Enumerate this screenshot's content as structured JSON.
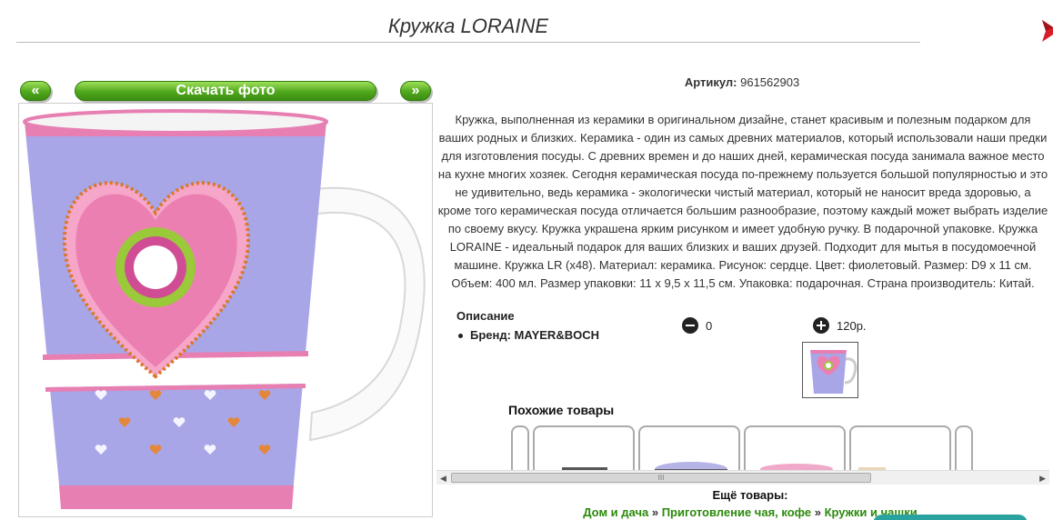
{
  "title": "Кружка LORAINE",
  "nav": {
    "prev": "«",
    "download": "Скачать фото",
    "next": "»"
  },
  "article": {
    "label": "Артикул:",
    "value": "961562903"
  },
  "description": "Кружка, выполненная из керамики в оригинальном дизайне, станет красивым и полезным подарком для ваших родных и близких. Керамика - один из самых древних материалов, который использовали наши предки для изготовления посуды. С древних времен и до наших дней, керамическая посуда занимала важное место на кухне многих хозяек. Сегодня керамическая посуда по-прежнему пользуется большой популярностью и это не удивительно, ведь керамика - экологически чистый материал, который не наносит вреда здоровью, а кроме того керамическая посуда отличается большим разнообразие, поэтому каждый может выбрать изделие по своему вкусу. Кружка украшена ярким рисунком и имеет удобную ручку. В подарочной упаковке. Кружка LORAINE - идеальный подарок для ваших близких и ваших друзей. Подходит для мытья в посудомоечной машине. Кружка LR (х48). Материал: керамика. Рисунок: сердце. Цвет: фиолетовый. Размер: D9 х 11 см. Объем: 400 мл. Размер упаковки: 11 х 9,5 х 11,5 см. Упаковка: подарочная. Страна производитель: Китай.",
  "specs": {
    "title": "Описание",
    "brand": "Бренд: MAYER&BOCH"
  },
  "quantity": {
    "value": "0",
    "price": "120р."
  },
  "similar": {
    "title": "Похожие товары"
  },
  "scrollbar": {
    "left": "◀",
    "grip": "III",
    "right": "▶"
  },
  "more": {
    "title": "Ещё товары:",
    "crumb1": "Дом и дача",
    "sep1": " » ",
    "crumb2": "Приготовление чая, кофе",
    "sep2": " » ",
    "crumb3": "Кружки и чашки"
  },
  "colors": {
    "green_button": "#4fa81c",
    "link_green": "#2b8a0c",
    "mug_lavender": "#a9a6e8",
    "mug_pink": "#e77fb3",
    "close_red": "#d81e2a"
  },
  "icons": {
    "close": "close-icon",
    "minus": "minus-circle-icon",
    "plus": "plus-circle-icon"
  }
}
